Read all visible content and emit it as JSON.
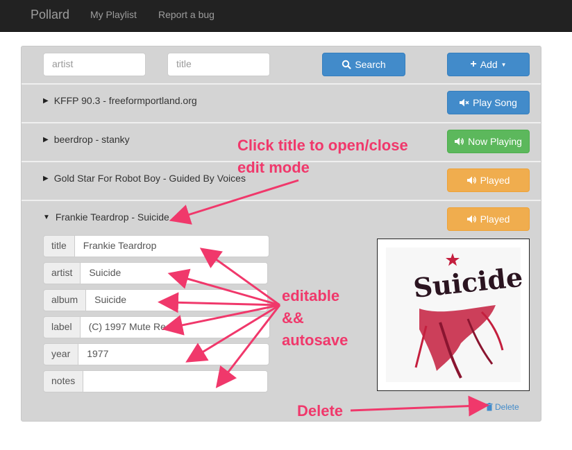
{
  "navbar": {
    "brand": "Pollard",
    "links": [
      "My Playlist",
      "Report a bug"
    ]
  },
  "search": {
    "artist_placeholder": "artist",
    "title_placeholder": "title",
    "search_label": "Search",
    "add_label": "Add"
  },
  "songs": [
    {
      "title": "KFFP 90.3 - freeformportland.org",
      "status": "Play Song",
      "status_icon": "volume-off-icon",
      "color": "#428bca",
      "expanded": false
    },
    {
      "title": "beerdrop - stanky",
      "status": "Now Playing",
      "status_icon": "volume-up-icon",
      "color": "#5cb85c",
      "expanded": false
    },
    {
      "title": "Gold Star For Robot Boy - Guided By Voices",
      "status": "Played",
      "status_icon": "volume-up-icon",
      "color": "#f0ad4e",
      "expanded": false
    },
    {
      "title": "Frankie Teardrop - Suicide",
      "status": "Played",
      "status_icon": "volume-up-icon",
      "color": "#f0ad4e",
      "expanded": true
    }
  ],
  "editor": {
    "fields": [
      {
        "label": "title",
        "value": "Frankie Teardrop"
      },
      {
        "label": "artist",
        "value": "Suicide"
      },
      {
        "label": "album",
        "value": "Suicide"
      },
      {
        "label": "label",
        "value": "(C) 1997 Mute Rec"
      },
      {
        "label": "year",
        "value": "1977"
      },
      {
        "label": "notes",
        "value": ""
      }
    ],
    "delete_label": "Delete"
  },
  "album_art": {
    "text": "Suicide",
    "background": "#f7f7f7",
    "accent": "#c41f3e"
  },
  "annotations": {
    "title_hint_line1": "Click title to open/close",
    "title_hint_line2": "edit mode",
    "editable_line1": "editable",
    "editable_line2": "&&",
    "editable_line3": "autosave",
    "delete_hint": "Delete"
  },
  "colors": {
    "annotation": "#f0386b",
    "primary": "#428bca",
    "success": "#5cb85c",
    "warning": "#f0ad4e"
  }
}
